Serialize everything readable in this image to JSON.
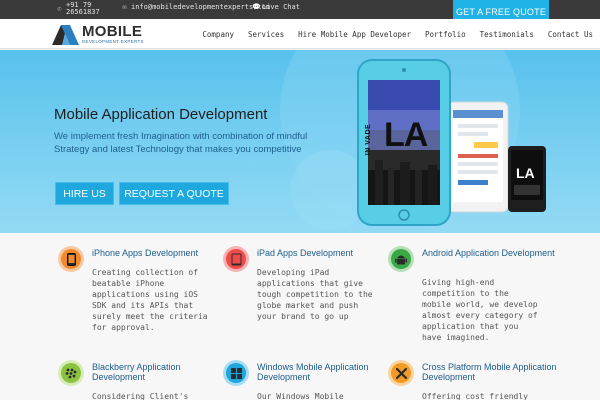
{
  "topbar": {
    "phone_line1": "+91 79",
    "phone_line2": "26561837",
    "email": "info@mobiledevelopmentexperts.com",
    "live_chat": "Live Chat",
    "quote_button": "GET A FREE QUOTE"
  },
  "logo": {
    "main": "MOBILE",
    "sub": "DEVELOPMENT EXPERTS"
  },
  "nav": {
    "items": [
      "Company",
      "Services",
      "Hire Mobile App Developer",
      "Portfolio",
      "Testimonials",
      "Contact Us"
    ]
  },
  "hero": {
    "title": "Mobile Application Development",
    "text": "We implement fresh Imagination with combination of mindful Strategy and latest Technology that makes you competitive",
    "hire_button": "HIRE US",
    "request_button": "REQUEST A QUOTE",
    "phone_screen_big": "LA",
    "phone_screen_small": "IN VADE"
  },
  "services": [
    {
      "title": "iPhone Apps Development",
      "desc": "Creating collection of beatable iPhone applications using iOS SDK and its APIs that surely meet the criteria for approval.",
      "color": "#f08a2b",
      "icon": "iphone-icon"
    },
    {
      "title": "iPad Apps Development",
      "desc": "Developing iPad applications that give tough competition to the globe market and push your brand to go up",
      "color": "#ef4b4b",
      "icon": "ipad-icon"
    },
    {
      "title": "Android Application Development",
      "desc": "Giving high-end competition to the mobile world, we develop almost every category of application that you have imagined.",
      "color": "#3aa845",
      "icon": "android-icon"
    },
    {
      "title": "Blackberry Application Development",
      "desc": "Considering Client's",
      "color": "#8ac43f",
      "icon": "blackberry-icon"
    },
    {
      "title": "Windows Mobile Application Development",
      "desc": "Our Windows Mobile",
      "color": "#1fa6dc",
      "icon": "windows-icon"
    },
    {
      "title": "Cross Platform Mobile Application Development",
      "desc": "Offering cost friendly",
      "color": "#f29a22",
      "icon": "cross-platform-icon"
    }
  ]
}
